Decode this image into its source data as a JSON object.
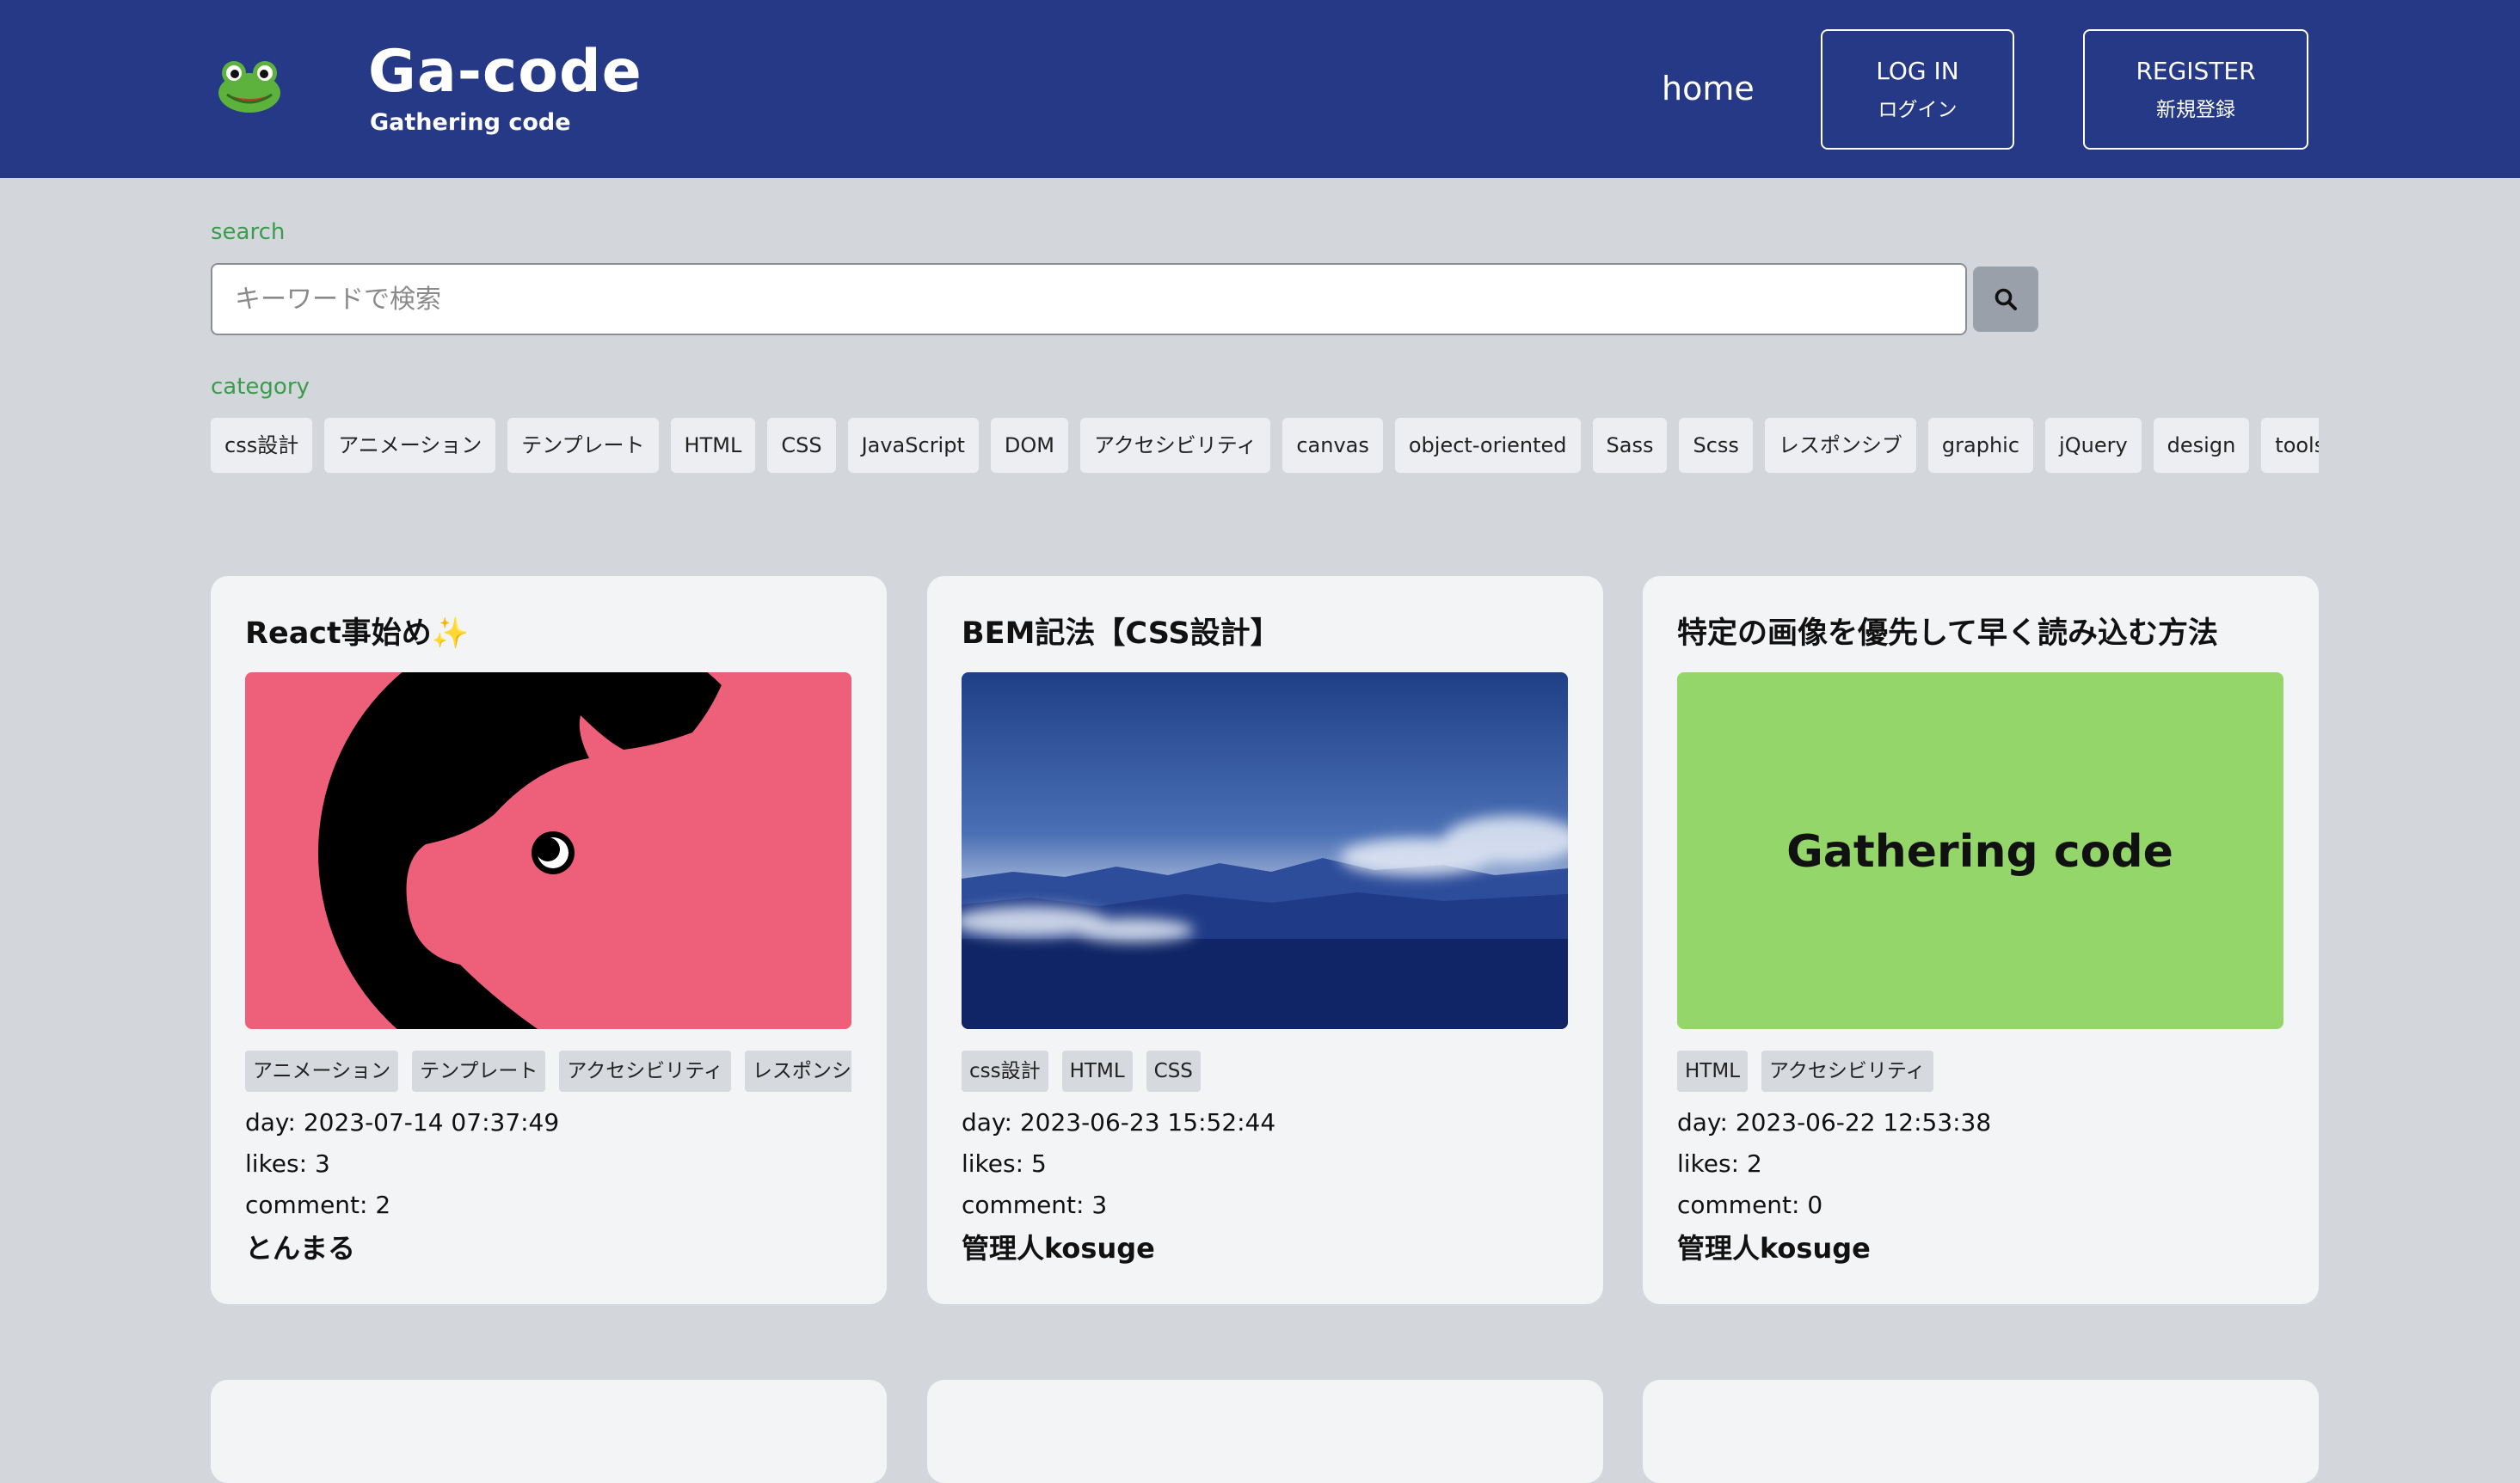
{
  "header": {
    "brand_title": "Ga-code",
    "brand_subtitle": "Gathering code",
    "nav_home": "home",
    "login": {
      "main": "LOG IN",
      "sub": "ログイン"
    },
    "register": {
      "main": "REGISTER",
      "sub": "新規登録"
    },
    "background_color": "#253986"
  },
  "search": {
    "label": "search",
    "placeholder": "キーワードで検索",
    "value": ""
  },
  "category": {
    "label": "category",
    "items": [
      "css設計",
      "アニメーション",
      "テンプレート",
      "HTML",
      "CSS",
      "JavaScript",
      "DOM",
      "アクセシビリティ",
      "canvas",
      "object-oriented",
      "Sass",
      "Scss",
      "レスポンシブ",
      "graphic",
      "jQuery",
      "design",
      "tools"
    ]
  },
  "posts": [
    {
      "title": "React事始め✨",
      "image": "pink-pig-illustration",
      "tags": [
        "アニメーション",
        "テンプレート",
        "アクセシビリティ",
        "レスポンシブ"
      ],
      "day_label": "day: ",
      "day": "2023-07-14 07:37:49",
      "likes_label": "likes: ",
      "likes": "3",
      "comment_label": "comment: ",
      "comment": "2",
      "author": "とんまる"
    },
    {
      "title": "BEM記法【CSS設計】",
      "image": "blue-mountain-sky",
      "tags": [
        "css設計",
        "HTML",
        "CSS"
      ],
      "day_label": "day: ",
      "day": "2023-06-23 15:52:44",
      "likes_label": "likes: ",
      "likes": "5",
      "comment_label": "comment: ",
      "comment": "3",
      "author": "管理人kosuge"
    },
    {
      "title": "特定の画像を優先して早く読み込む方法",
      "image": "green-gathering-code",
      "image_text": "Gathering code",
      "tags": [
        "HTML",
        "アクセシビリティ"
      ],
      "day_label": "day: ",
      "day": "2023-06-22 12:53:38",
      "likes_label": "likes: ",
      "likes": "2",
      "comment_label": "comment: ",
      "comment": "0",
      "author": "管理人kosuge"
    }
  ],
  "colors": {
    "page_bg": "#d3d7dc",
    "accent_green": "#3b9c4c",
    "card_bg": "#f2f4f6",
    "pig_bg": "#ee6079",
    "gc_green": "#95d66a"
  },
  "icons": {
    "logo": "frog-icon",
    "search": "search-icon"
  }
}
